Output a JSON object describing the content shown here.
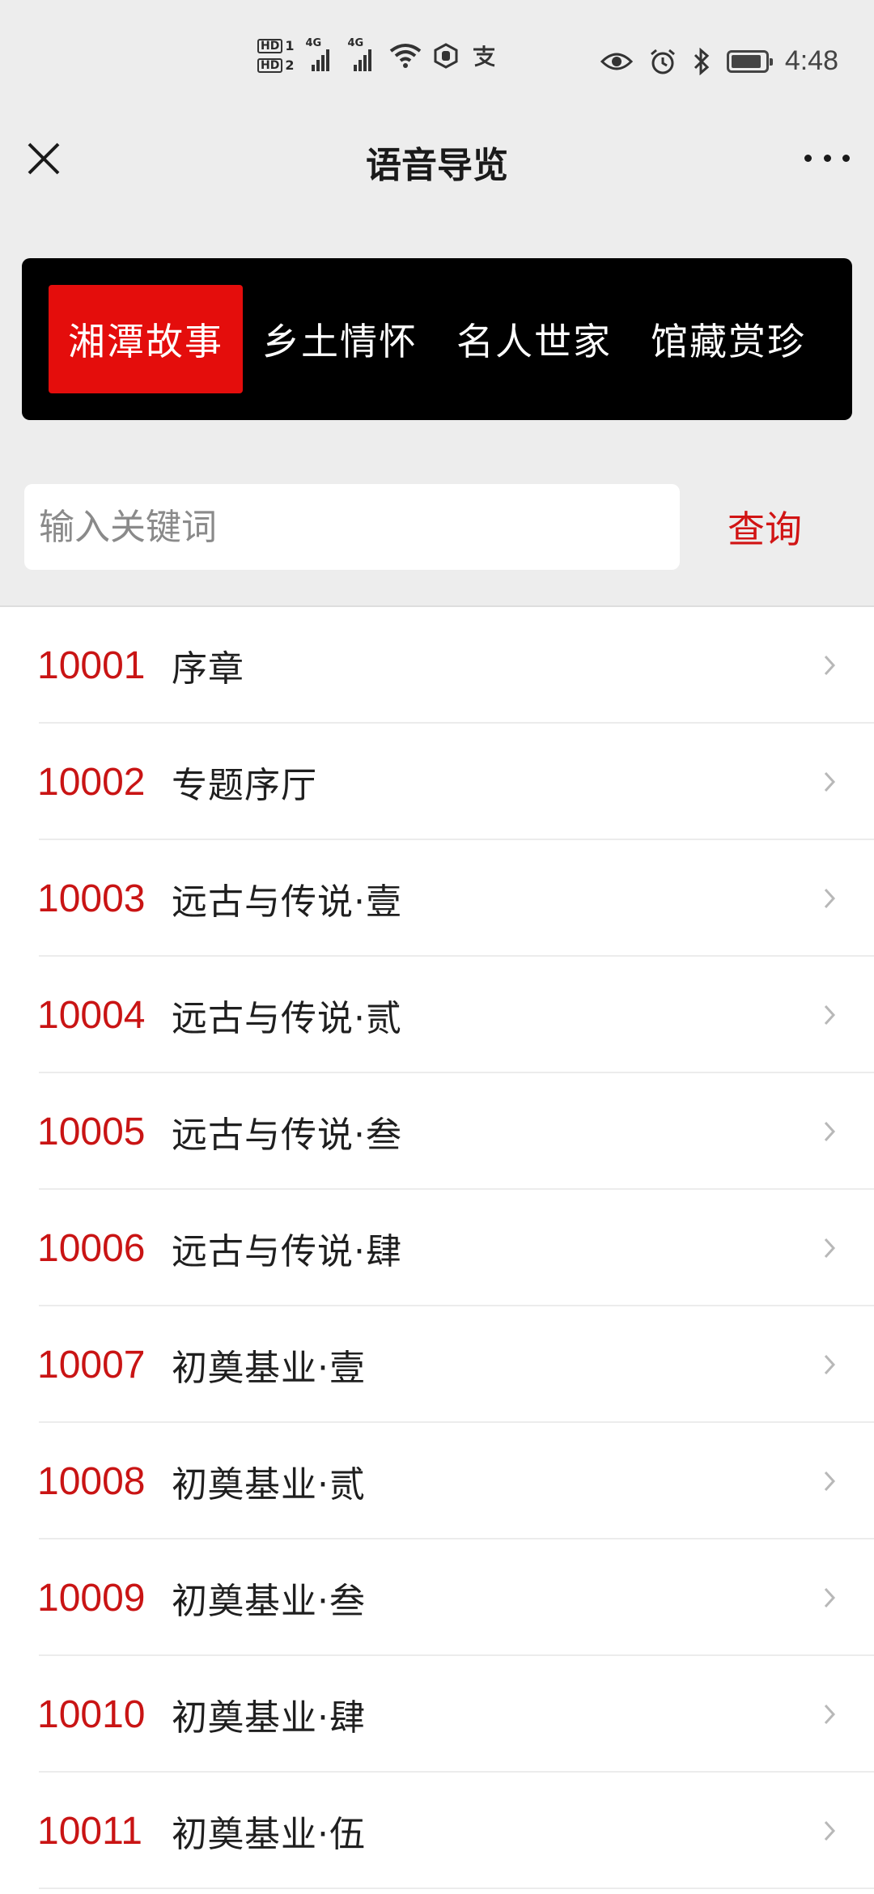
{
  "status_bar": {
    "hd1": "HD",
    "hd1_slot": "1",
    "hd2": "HD",
    "hd2_slot": "2",
    "net1": "4G",
    "net2": "4G",
    "time": "4:48"
  },
  "header": {
    "title": "语音导览"
  },
  "tabs": [
    {
      "label": "湘潭故事",
      "active": true
    },
    {
      "label": "乡土情怀",
      "active": false
    },
    {
      "label": "名人世家",
      "active": false
    },
    {
      "label": "馆藏赏珍",
      "active": false
    }
  ],
  "search": {
    "placeholder": "输入关键词",
    "value": "",
    "button_label": "查询"
  },
  "list": [
    {
      "code": "10001",
      "name": "序章"
    },
    {
      "code": "10002",
      "name": "专题序厅"
    },
    {
      "code": "10003",
      "name": "远古与传说·壹"
    },
    {
      "code": "10004",
      "name": "远古与传说·贰"
    },
    {
      "code": "10005",
      "name": "远古与传说·叁"
    },
    {
      "code": "10006",
      "name": "远古与传说·肆"
    },
    {
      "code": "10007",
      "name": "初奠基业·壹"
    },
    {
      "code": "10008",
      "name": "初奠基业·贰"
    },
    {
      "code": "10009",
      "name": "初奠基业·叁"
    },
    {
      "code": "10010",
      "name": "初奠基业·肆"
    },
    {
      "code": "10011",
      "name": "初奠基业·伍"
    }
  ],
  "colors": {
    "accent": "#c91414",
    "tab_active": "#e40d0c",
    "tab_bar": "#000000",
    "background": "#ededed"
  },
  "icons": {
    "close": "close-icon",
    "more": "more-icon",
    "chevron": "chevron-right-icon"
  }
}
